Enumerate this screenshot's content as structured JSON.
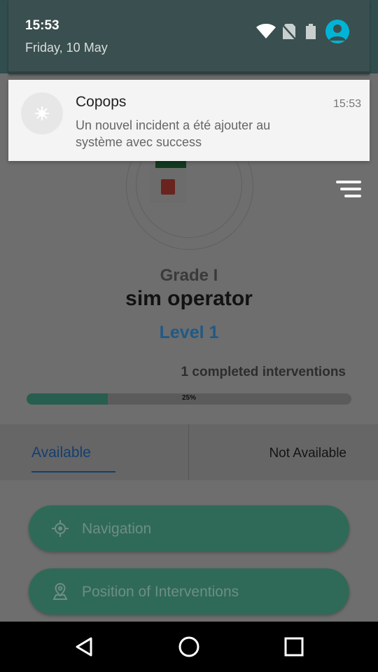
{
  "status_bar": {
    "time": "15:53",
    "date": "Friday, 10 May",
    "icons": [
      "wifi-icon",
      "no-sim-icon",
      "battery-icon",
      "account-icon"
    ]
  },
  "notification": {
    "app_name": "Copops",
    "time": "15:53",
    "message": "Un nouvel incident a été ajouter  au\nsystème avec success",
    "icon": "app-badge-icon"
  },
  "profile": {
    "grade": "Grade   I",
    "role": "sim operator",
    "level": "Level 1",
    "completed": "1 completed interventions",
    "progress_label": "25%",
    "progress_value": 0.25
  },
  "tabs": {
    "available": "Available",
    "not_available": "Not Available"
  },
  "actions": {
    "navigation": "Navigation",
    "positions": "Position of Interventions"
  },
  "colors": {
    "accent": "#00b4d6",
    "primary": "#2f6a58",
    "tab_active": "#143f6f",
    "level_text": "#1f5a86"
  },
  "menu_icon": "menu-icon"
}
